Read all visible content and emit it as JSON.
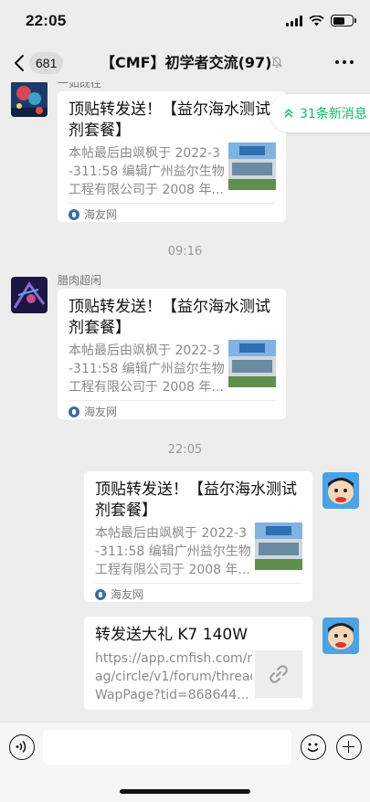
{
  "status_bar": {
    "time": "22:05"
  },
  "nav": {
    "back_count": "681",
    "title": "【CMF】初学者交流(97)"
  },
  "new_messages": {
    "label": "31条新消息"
  },
  "messages": [
    {
      "sender": "一如既往",
      "title": "顶贴转发送！【益尔海水测试剂套餐】",
      "desc": [
        "本帖最后由飒枫于 2022-3",
        "-311:58 编辑广州益尔生物",
        "工程有限公司于 2008 年..."
      ],
      "source": "海友网"
    },
    {
      "sender": "腊肉超闲",
      "title": "顶贴转发送！【益尔海水测试剂套餐】",
      "desc": [
        "本帖最后由飒枫于 2022-3",
        "-311:58 编辑广州益尔生物",
        "工程有限公司于 2008 年..."
      ],
      "source": "海友网"
    },
    {
      "title": "顶贴转发送！【益尔海水测试剂套餐】",
      "desc": [
        "本帖最后由飒枫于 2022-3",
        "-311:58 编辑广州益尔生物",
        "工程有限公司于 2008 年..."
      ],
      "source": "海友网"
    },
    {
      "title": "转发送大礼 K7 140W",
      "desc": [
        "https://app.cmfish.com/m",
        "ag/circle/v1/forum/thread",
        "WapPage?tid=868644..."
      ]
    }
  ],
  "time_separators": [
    "09:16",
    "22:05"
  ],
  "colors": {
    "accent": "#07c160",
    "background": "#ededed"
  }
}
